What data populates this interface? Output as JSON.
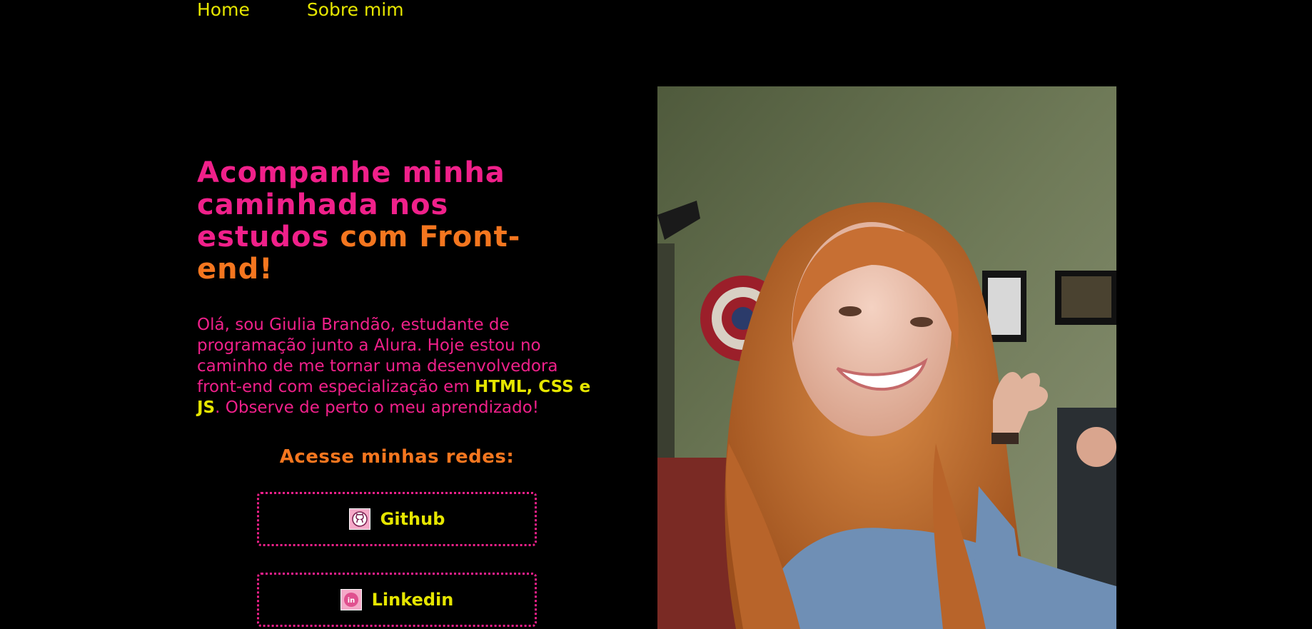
{
  "nav": {
    "items": [
      {
        "label": "Home"
      },
      {
        "label": "Sobre mim"
      }
    ]
  },
  "hero": {
    "headline_part1": "Acompanhe minha caminhada nos estudos",
    "headline_part2": "com Front-end!",
    "intro_before": "Olá, sou Giulia Brandão, estudante de programação junto a Alura. Hoje estou no caminho de me tornar uma desenvolvedora front-end com especialização em",
    "intro_highlight": "HTML, CSS e JS",
    "intro_after": ". Observe de perto o meu aprendizado!"
  },
  "social": {
    "title": "Acesse minhas redes:",
    "links": [
      {
        "label": "Github",
        "icon": "github-icon"
      },
      {
        "label": "Linkedin",
        "icon": "linkedin-icon"
      }
    ]
  },
  "colors": {
    "background": "#000000",
    "pink": "#f0208a",
    "orange": "#f4761f",
    "yellow": "#e6e600"
  }
}
